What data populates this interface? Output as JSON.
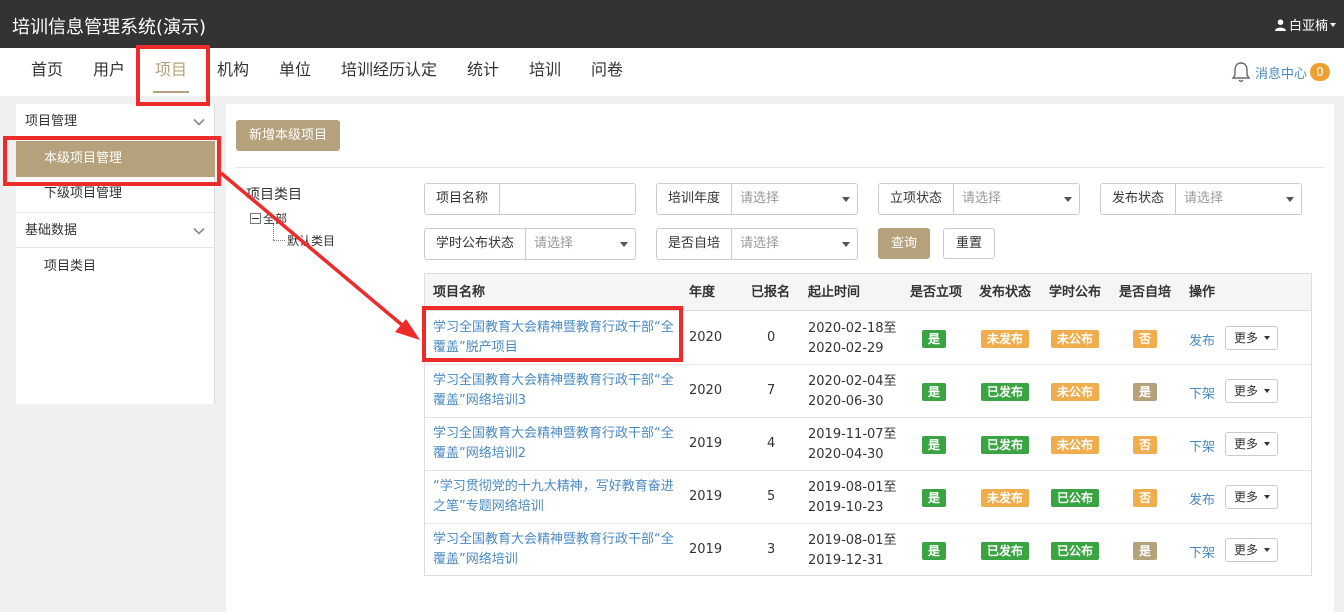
{
  "app": {
    "title": "培训信息管理系统(演示)"
  },
  "user": {
    "name": "白亚楠"
  },
  "nav": {
    "items": [
      {
        "label": "首页"
      },
      {
        "label": "用户"
      },
      {
        "label": "项目",
        "active": true
      },
      {
        "label": "机构"
      },
      {
        "label": "单位"
      },
      {
        "label": "培训经历认定"
      },
      {
        "label": "统计"
      },
      {
        "label": "培训"
      },
      {
        "label": "问卷"
      }
    ],
    "message_center": "消息中心",
    "message_count": "0"
  },
  "sidebar": {
    "group1": "项目管理",
    "item_local": "本级项目管理",
    "item_sub": "下级项目管理",
    "group2": "基础数据",
    "item_category": "项目类目"
  },
  "toolbar": {
    "add_button": "新增本级项目"
  },
  "tree": {
    "title": "项目类目",
    "root": "全部",
    "child": "默认类目"
  },
  "filters": {
    "name_label": "项目名称",
    "name_value": "",
    "year_label": "培训年度",
    "approval_label": "立项状态",
    "publish_label": "发布状态",
    "hours_label": "学时公布状态",
    "self_label": "是否自培",
    "placeholder": "请选择",
    "query_button": "查询",
    "reset_button": "重置"
  },
  "table": {
    "headers": [
      "项目名称",
      "年度",
      "已报名",
      "起止时间",
      "是否立项",
      "发布状态",
      "学时公布",
      "是否自培",
      "操作"
    ],
    "more_label": "更多",
    "rows": [
      {
        "name": "学习全国教育大会精神暨教育行政干部“全覆盖”脱产项目",
        "year": "2020",
        "enrolled": "0",
        "start": "2020-02-18至",
        "end": "2020-02-29",
        "approved": "是",
        "publish": "未发布",
        "hours": "未公布",
        "self": "否",
        "action": "发布"
      },
      {
        "name": "学习全国教育大会精神暨教育行政干部“全覆盖”网络培训3",
        "year": "2020",
        "enrolled": "7",
        "start": "2020-02-04至",
        "end": "2020-06-30",
        "approved": "是",
        "publish": "已发布",
        "hours": "未公布",
        "self": "是",
        "action": "下架"
      },
      {
        "name": "学习全国教育大会精神暨教育行政干部“全覆盖”网络培训2",
        "year": "2019",
        "enrolled": "4",
        "start": "2019-11-07至",
        "end": "2020-04-30",
        "approved": "是",
        "publish": "已发布",
        "hours": "未公布",
        "self": "否",
        "action": "下架"
      },
      {
        "name": "“学习贯彻党的十九大精神，写好教育奋进之笔”专题网络培训",
        "year": "2019",
        "enrolled": "5",
        "start": "2019-08-01至",
        "end": "2019-10-23",
        "approved": "是",
        "publish": "未发布",
        "hours": "已公布",
        "self": "否",
        "action": "发布"
      },
      {
        "name": "学习全国教育大会精神暨教育行政干部“全覆盖”网络培训",
        "year": "2019",
        "enrolled": "3",
        "start": "2019-08-01至",
        "end": "2019-12-31",
        "approved": "是",
        "publish": "已发布",
        "hours": "已公布",
        "self": "是",
        "action": "下架"
      }
    ]
  },
  "colors": {
    "accent": "#b5a27c",
    "link": "#4a8ac3",
    "green": "#3aa342",
    "orange": "#f0ad4e",
    "annotation": "#ee2b2b",
    "topbar": "#333333"
  }
}
